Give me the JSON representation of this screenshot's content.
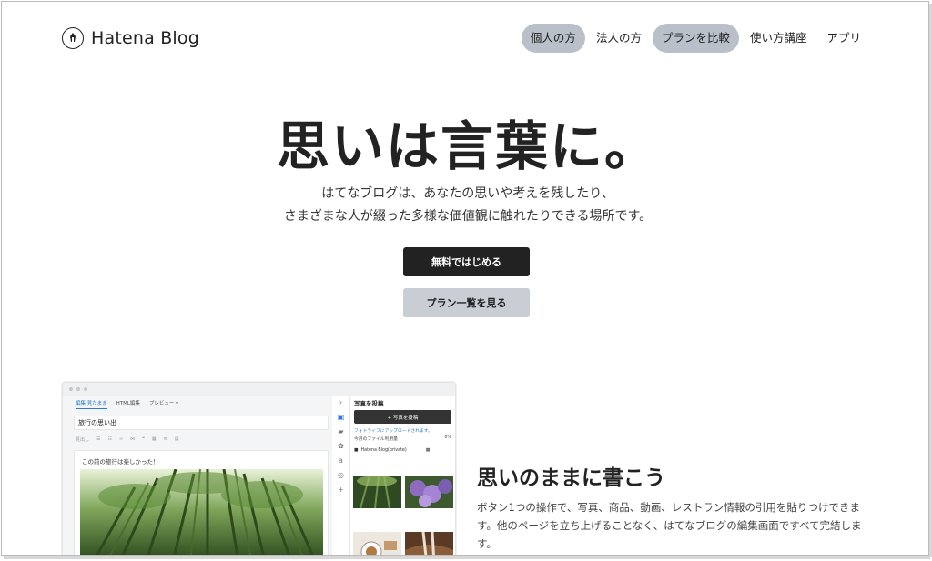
{
  "header": {
    "logo_text": "Hatena Blog",
    "nav": [
      {
        "label": "個人の方",
        "highlighted": true
      },
      {
        "label": "法人の方",
        "highlighted": false
      },
      {
        "label": "プランを比較",
        "highlighted": true
      },
      {
        "label": "使い方講座",
        "highlighted": false
      },
      {
        "label": "アプリ",
        "highlighted": false
      }
    ]
  },
  "hero": {
    "title": "思いは言葉に。",
    "subtitle_line1": "はてなブログは、あなたの思いや考えを残したり、",
    "subtitle_line2": "さまざまな人が綴った多様な価値観に触れたりできる場所です。",
    "primary_button": "無料ではじめる",
    "secondary_button": "プラン一覧を見る"
  },
  "editor_mock": {
    "tabs": [
      "編集 見たまま",
      "HTML編集",
      "プレビュー ▾"
    ],
    "title_value": "旅行の思い出",
    "toolbar_label": "見出し",
    "body_text": "この前の旅行は楽しかった！",
    "panel_title": "写真を投稿",
    "upload_button": "+ 写真を投稿",
    "upload_note": "フォトライフにアップロードされます。",
    "usage_label": "今月のファイル利用量",
    "usage_value": "0%",
    "folder_select": "Hatena Blog(private)"
  },
  "feature": {
    "title": "思いのままに書こう",
    "body": "ボタン1つの操作で、写真、商品、動画、レストラン情報の引用を貼りつけできます。他のページを立ち上げることなく、はてなブログの編集画面ですべて完結します。"
  },
  "colors": {
    "accent_dark": "#222222",
    "pill_bg": "#b9c0c9",
    "secondary_btn": "#c9ced4",
    "link_blue": "#2a7bd1"
  }
}
